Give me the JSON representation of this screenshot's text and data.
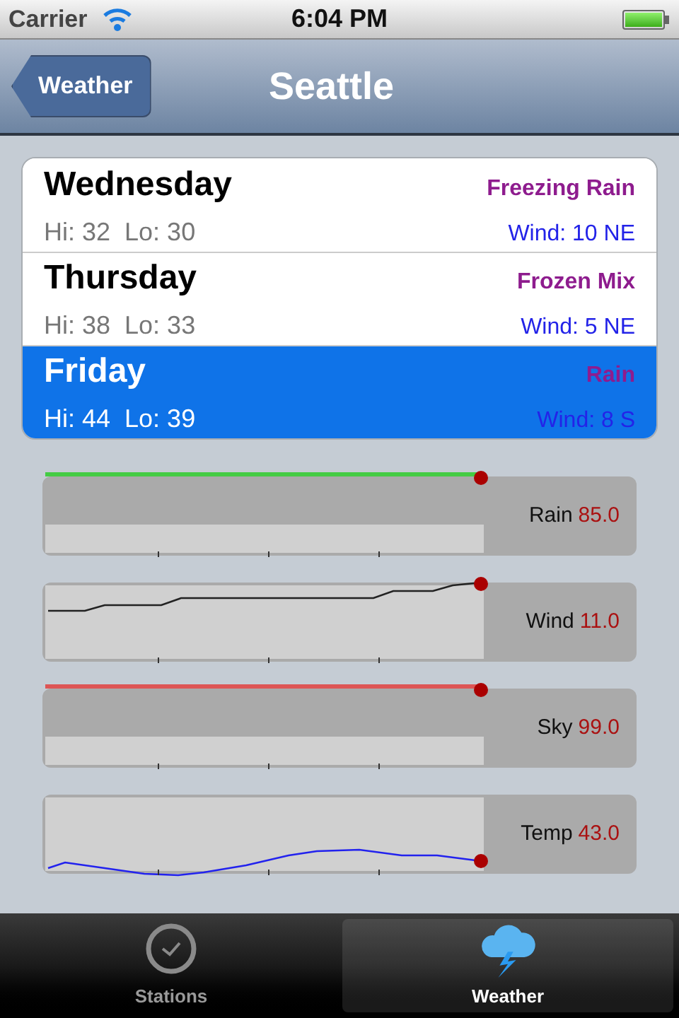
{
  "status_bar": {
    "carrier": "Carrier",
    "time": "6:04 PM"
  },
  "nav_bar": {
    "back": "Weather",
    "title": "Seattle"
  },
  "forecast": [
    {
      "day": "Wednesday",
      "hi": "Hi: 32",
      "lo": "Lo: 30",
      "condition": "Freezing Rain",
      "wind": "Wind: 10 NE",
      "selected": false
    },
    {
      "day": "Thursday",
      "hi": "Hi: 38",
      "lo": "Lo: 33",
      "condition": "Frozen Mix",
      "wind": "Wind: 5 NE",
      "selected": false
    },
    {
      "day": "Friday",
      "hi": "Hi: 44",
      "lo": "Lo: 39",
      "condition": "Rain",
      "wind": "Wind: 8 S",
      "selected": true
    }
  ],
  "gauges": [
    {
      "kind": "flat",
      "label": "Rain",
      "value": "85.0",
      "color": "#44cc44"
    },
    {
      "kind": "step",
      "label": "Wind",
      "value": "11.0",
      "color": "#222222"
    },
    {
      "kind": "flat",
      "label": "Sky",
      "value": "99.0",
      "color": "#dd5555"
    },
    {
      "kind": "wave",
      "label": "Temp",
      "value": "43.0",
      "color": "#2222ee"
    }
  ],
  "tab_bar": [
    {
      "label": "Stations",
      "kind": "clock",
      "selected": false
    },
    {
      "label": "Weather",
      "kind": "storm",
      "selected": true
    }
  ]
}
